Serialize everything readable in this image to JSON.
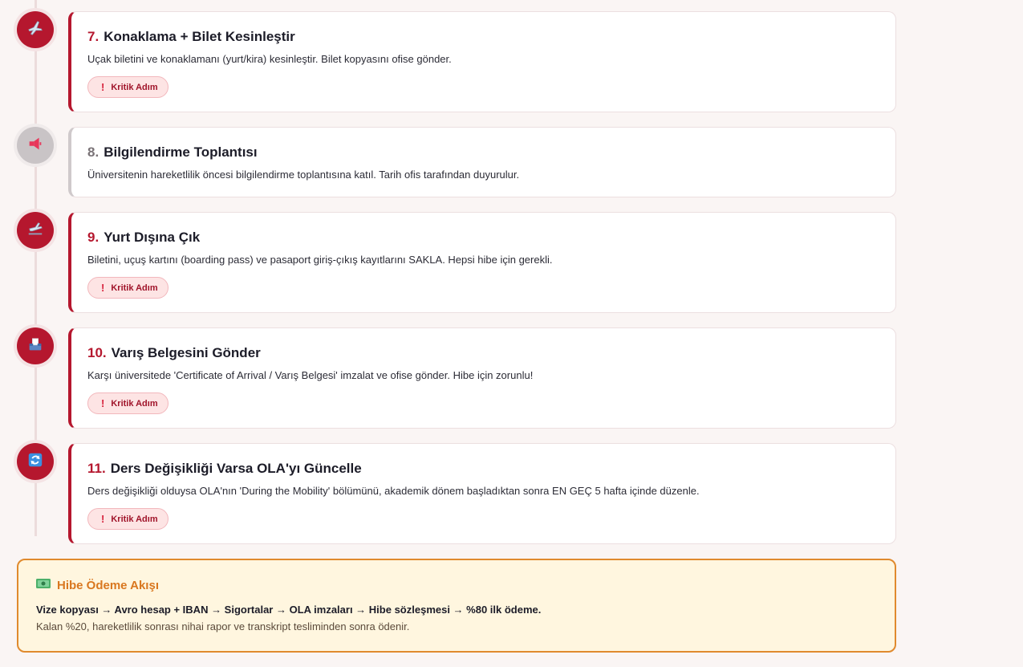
{
  "steps": [
    {
      "num": "7.",
      "title": "Konaklama + Bilet Kesinleştir",
      "desc": "Uçak biletini ve konaklamanı (yurt/kira) kesinleştir. Bilet kopyasını ofise gönder.",
      "badge": "Kritik Adım",
      "icon": "airplane-icon",
      "critical": true
    },
    {
      "num": "8.",
      "title": "Bilgilendirme Toplantısı",
      "desc": "Üniversitenin hareketlilik öncesi bilgilendirme toplantısına katıl. Tarih ofis tarafından duyurulur.",
      "badge": "",
      "icon": "megaphone-icon",
      "critical": false
    },
    {
      "num": "9.",
      "title": "Yurt Dışına Çık",
      "desc": "Biletini, uçuş kartını (boarding pass) ve pasaport giriş-çıkış kayıtlarını SAKLA. Hepsi hibe için gerekli.",
      "badge": "Kritik Adım",
      "icon": "departure-icon",
      "critical": true
    },
    {
      "num": "10.",
      "title": "Varış Belgesini Gönder",
      "desc": "Karşı üniversitede 'Certificate of Arrival / Varış Belgesi' imzalat ve ofise gönder. Hibe için zorunlu!",
      "badge": "Kritik Adım",
      "icon": "inbox-tray-icon",
      "critical": true
    },
    {
      "num": "11.",
      "title": "Ders Değişikliği Varsa OLA'yı Güncelle",
      "desc": "Ders değişikliği olduysa OLA'nın 'During the Mobility' bölümünü, akademik dönem başladıktan sonra EN GEÇ 5 hafta içinde düzenle.",
      "badge": "Kritik Adım",
      "icon": "refresh-icon",
      "critical": true
    }
  ],
  "grant": {
    "icon": "money-icon",
    "title": "Hibe Ödeme Akışı",
    "flow": "Vize kopyası → Avro hesap + IBAN → Sigortalar → OLA imzaları → Hibe sözleşmesi → %80 ilk ödeme.",
    "note": "Kalan %20, hareketlilik sonrası nihai rapor ve transkript tesliminden sonra ödenir."
  },
  "colors": {
    "accent": "#b5172e",
    "muted": "#cfc9cb",
    "grant_border": "#e08a2e",
    "grant_bg": "#fff6df",
    "badge_bg": "#fde4e4"
  }
}
